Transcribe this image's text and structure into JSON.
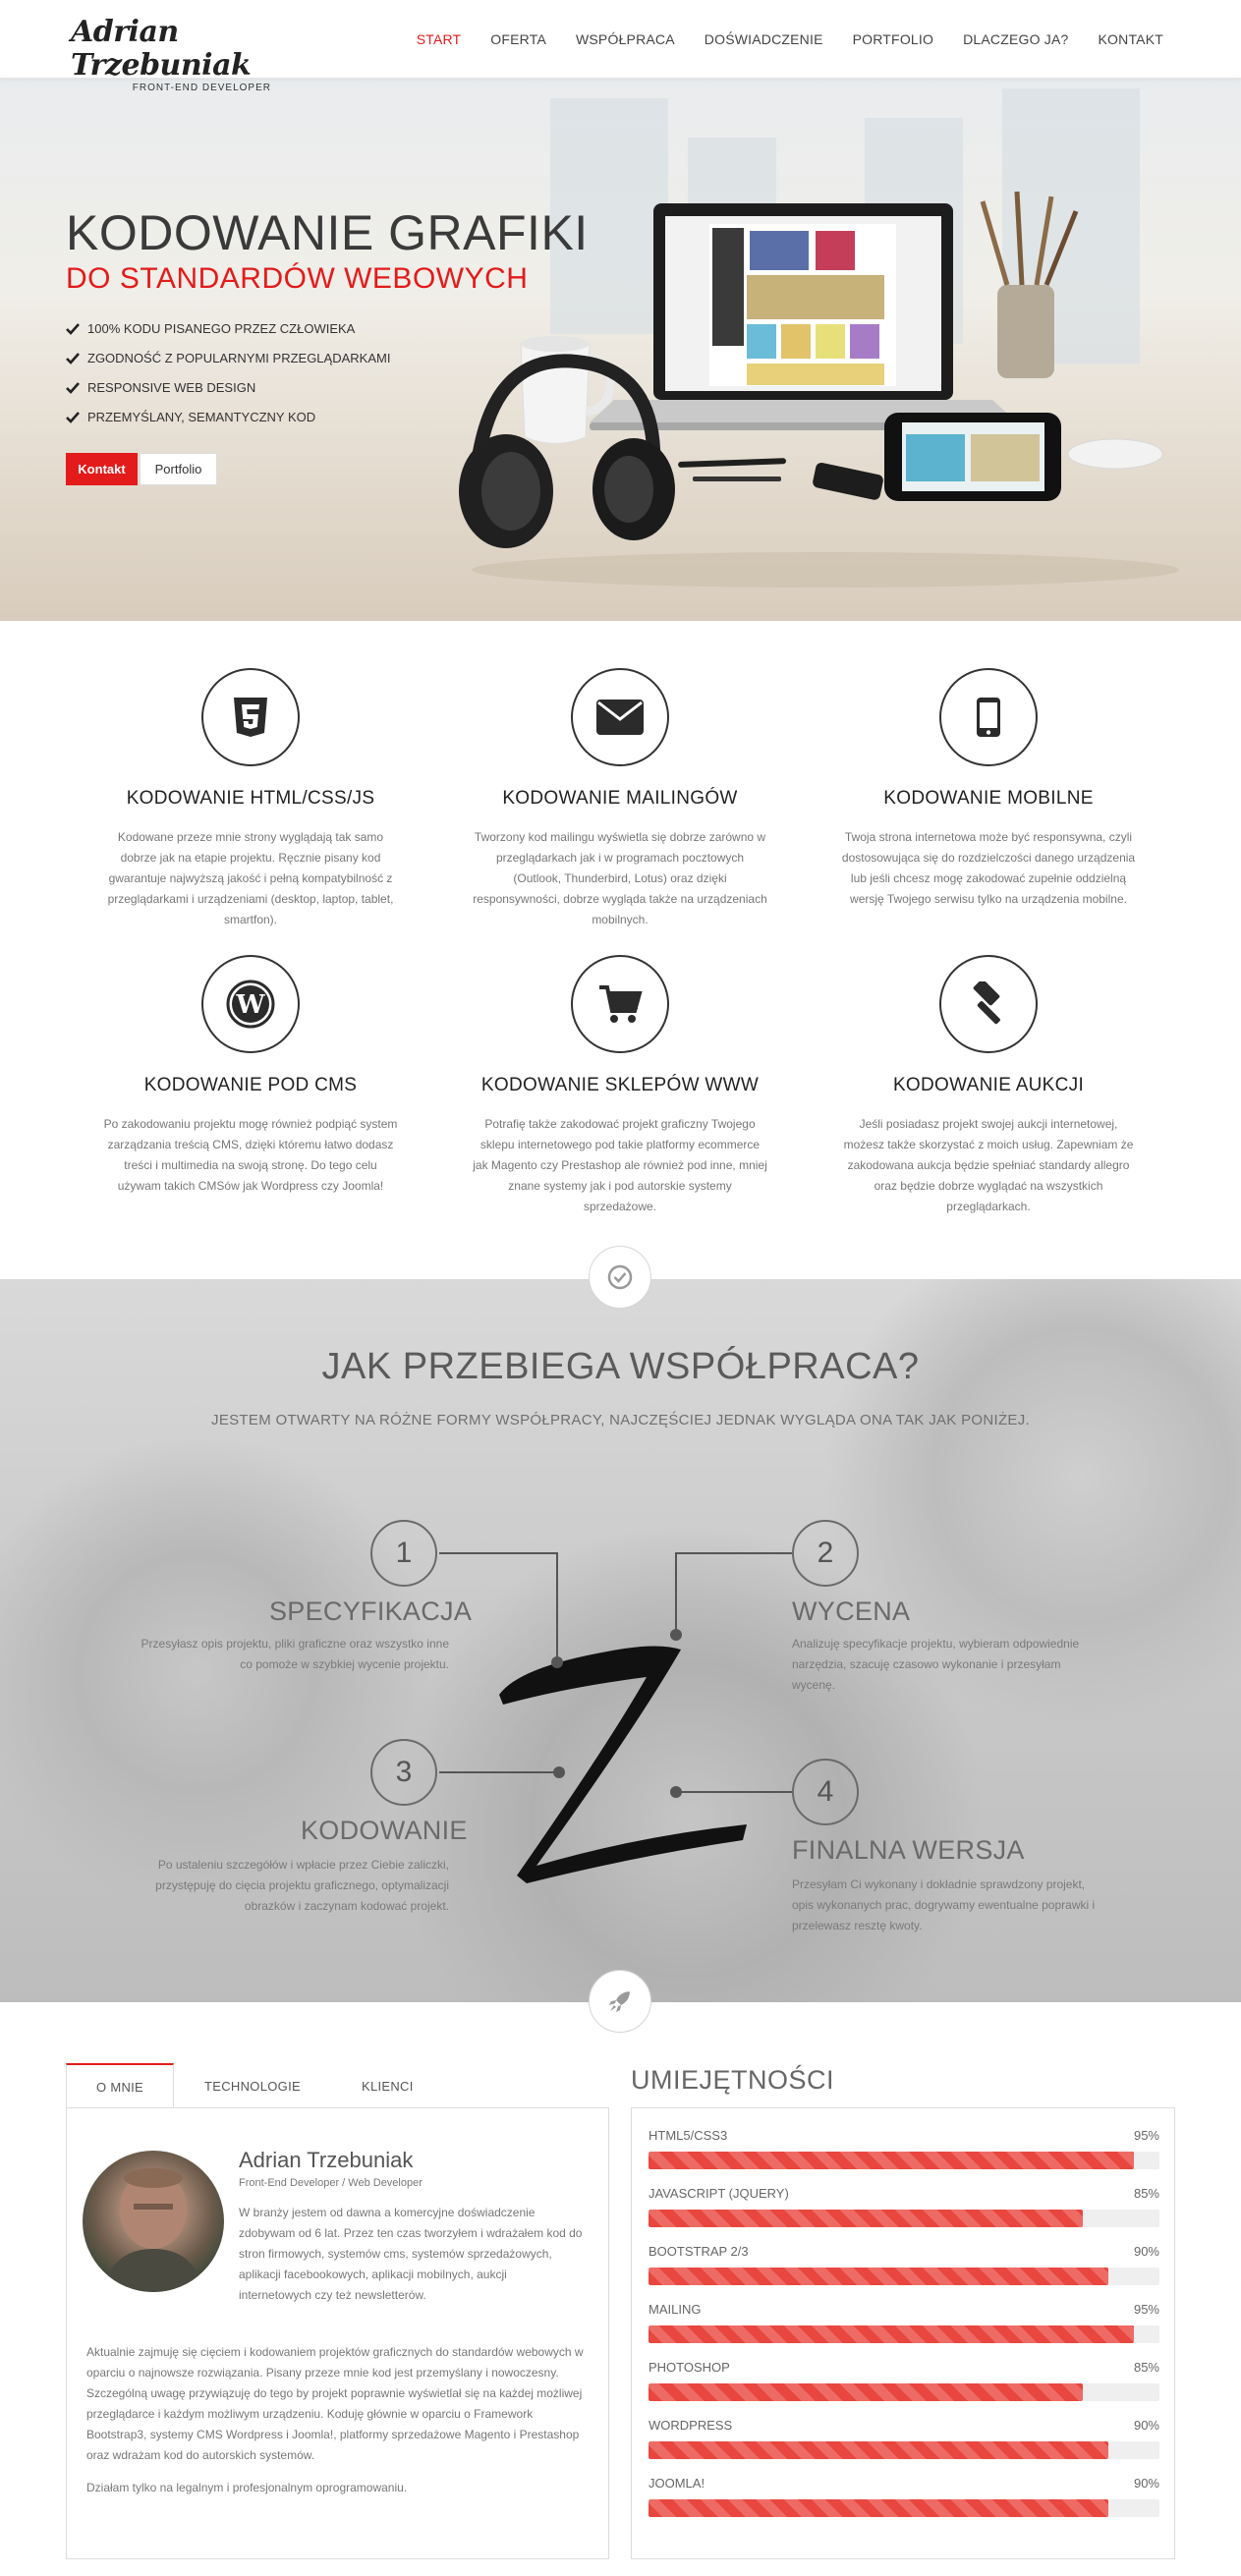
{
  "nav": {
    "logo_name": "Adrian Trzebuniak",
    "logo_sub": "FRONT-END DEVELOPER",
    "items": [
      "START",
      "OFERTA",
      "WSPÓŁPRACA",
      "DOŚWIADCZENIE",
      "PORTFOLIO",
      "DLACZEGO JA?",
      "KONTAKT"
    ],
    "active_index": 0
  },
  "hero": {
    "title": "KODOWANIE GRAFIKI",
    "subtitle": "DO STANDARDÓW WEBOWYCH",
    "bullets": [
      "100% KODU PISANEGO PRZEZ CZŁOWIEKA",
      "ZGODNOŚĆ Z POPULARNYMI PRZEGLĄDARKAMI",
      "RESPONSIVE WEB DESIGN",
      "PRZEMYŚLANY, SEMANTYCZNY KOD"
    ],
    "btn_contact": "Kontakt",
    "btn_portfolio": "Portfolio",
    "accent": "#e31b1b"
  },
  "services": [
    {
      "icon": "html5-icon",
      "title": "KODOWANIE HTML/CSS/JS",
      "desc": "Kodowane przeze mnie strony wyglądają tak samo dobrze jak na etapie projektu. Ręcznie pisany kod gwarantuje najwyższą jakość i pełną kompatybilność z przeglądarkami i urządzeniami (desktop, laptop, tablet, smartfon)."
    },
    {
      "icon": "envelope-icon",
      "title": "KODOWANIE MAILINGÓW",
      "desc": "Tworzony kod mailingu wyświetla się dobrze zarówno w przeglądarkach jak i w programach pocztowych (Outlook, Thunderbird, Lotus) oraz dzięki responsywności, dobrze wygląda także na urządzeniach mobilnych."
    },
    {
      "icon": "mobile-icon",
      "title": "KODOWANIE MOBILNE",
      "desc": "Twoja strona internetowa może być responsywna, czyli dostosowująca się do rozdzielczości danego urządzenia lub jeśli chcesz mogę zakodować zupełnie oddzielną wersję Twojego serwisu tylko na urządzenia mobilne."
    },
    {
      "icon": "wordpress-icon",
      "title": "KODOWANIE POD CMS",
      "desc": "Po zakodowaniu projektu mogę również podpiąć system zarządzania treścią CMS, dzięki któremu łatwo dodasz treści i multimedia na swoją stronę. Do tego celu używam takich CMSów jak Wordpress czy Joomla!"
    },
    {
      "icon": "cart-icon",
      "title": "KODOWANIE SKLEPÓW WWW",
      "desc": "Potrafię także zakodować projekt graficzny Twojego sklepu internetowego pod takie platformy ecommerce jak Magento czy Prestashop ale również pod inne, mniej znane systemy jak i pod autorskie systemy sprzedażowe."
    },
    {
      "icon": "gavel-icon",
      "title": "KODOWANIE AUKCJI",
      "desc": "Jeśli posiadasz projekt swojej aukcji internetowej, możesz także skorzystać z moich usług. Zapewniam że zakodowana aukcja będzie spełniać standardy allegro oraz będzie dobrze wyglądać na wszystkich przeglądarkach."
    }
  ],
  "process": {
    "title": "JAK PRZEBIEGA WSPÓŁPRACA?",
    "subtitle": "JESTEM OTWARTY NA RÓŻNE FORMY WSPÓŁPRACY, NAJCZĘŚCIEJ JEDNAK WYGLĄDA ONA TAK JAK PONIŻEJ.",
    "steps": [
      {
        "num": "1",
        "title": "SPECYFIKACJA",
        "desc": "Przesyłasz opis projektu, pliki graficzne oraz wszystko inne co pomoże w szybkiej wycenie projektu."
      },
      {
        "num": "2",
        "title": "WYCENA",
        "desc": "Analizuję specyfikacje projektu, wybieram odpowiednie narzędzia, szacuję czasowo wykonanie i przesyłam wycenę."
      },
      {
        "num": "3",
        "title": "KODOWANIE",
        "desc": "Po ustaleniu szczegółów i wpłacie przez Ciebie zaliczki, przystępuję do cięcia projektu graficznego, optymalizacji obrazków i zaczynam kodować projekt."
      },
      {
        "num": "4",
        "title": "FINALNA WERSJA",
        "desc": "Przesyłam Ci wykonany i dokładnie sprawdzony projekt, opis wykonanych prac, dogrywamy ewentualne poprawki i przelewasz resztę kwoty."
      }
    ]
  },
  "about": {
    "tabs": [
      "O MNIE",
      "TECHNOLOGIE",
      "KLIENCI"
    ],
    "name": "Adrian Trzebuniak",
    "role": "Front-End Developer / Web Developer",
    "p1": "W branży jestem od dawna a komercyjne doświadczenie zdobywam od 6 lat. Przez ten czas tworzyłem i wdrażałem kod do stron firmowych, systemów cms, systemów sprzedażowych, aplikacji facebookowych, aplikacji mobilnych, aukcji internetowych czy też newsletterów.",
    "p2": "Aktualnie zajmuję się cięciem i kodowaniem projektów graficznych do standardów webowych w oparciu o najnowsze rozwiązania. Pisany przeze mnie kod jest przemyślany i nowoczesny. Szczególną uwagę przywiązuję do tego by projekt poprawnie wyświetlał się na każdej możliwej przeglądarce i każdym możliwym urządzeniu. Koduję głównie w oparciu o Framework Bootstrap3, systemy CMS Wordpress i Joomla!, platformy sprzedażowe Magento i Prestashop oraz wdrażam kod do autorskich systemów.",
    "p3": "Działam tylko na legalnym i profesjonalnym oprogramowaniu."
  },
  "skills": {
    "title": "UMIEJĘTNOŚCI",
    "items": [
      {
        "name": "HTML5/CSS3",
        "pct": "95%",
        "value": 95
      },
      {
        "name": "JAVASCRIPT (JQUERY)",
        "pct": "85%",
        "value": 85
      },
      {
        "name": "BOOTSTRAP 2/3",
        "pct": "90%",
        "value": 90
      },
      {
        "name": "MAILING",
        "pct": "95%",
        "value": 95
      },
      {
        "name": "PHOTOSHOP",
        "pct": "85%",
        "value": 85
      },
      {
        "name": "WORDPRESS",
        "pct": "90%",
        "value": 90
      },
      {
        "name": "JOOMLA!",
        "pct": "90%",
        "value": 90
      }
    ]
  }
}
